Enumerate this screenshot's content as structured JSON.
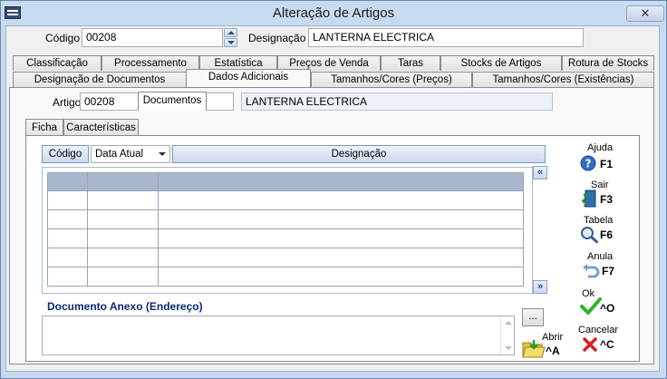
{
  "window": {
    "title": "Alteração de Artigos",
    "close_label": "✕"
  },
  "header": {
    "code_label": "Código",
    "code_value": "00208",
    "designation_label": "Designação",
    "designation_value": "LANTERNA ELECTRICA"
  },
  "tabs_row1": [
    "Classificação",
    "Processamento",
    "Estatística",
    "Preços de Venda",
    "Taras",
    "Stocks de Artigos",
    "Rotura de Stocks"
  ],
  "tabs_row2": [
    "Designação de Documentos",
    "Dados Adicionais",
    "Tamanhos/Cores (Preços)",
    "Tamanhos/Cores (Existências)"
  ],
  "active_tab": "Dados Adicionais",
  "panel": {
    "article_label": "Artigo",
    "article_code": "00208",
    "article_name": "LANTERNA ELECTRICA",
    "inner_tabs": [
      "Ficha",
      "Características",
      "Documentos"
    ],
    "active_inner_tab": "Documentos",
    "grid": {
      "code_button": "Código",
      "date_select": "Data Atual",
      "designation_button": "Designação",
      "scroll_up": "«",
      "scroll_down": "»"
    },
    "attachment_label": "Documento Anexo (Endereço)",
    "browse_label": "...",
    "open_label": "Abrir",
    "open_key": "^A"
  },
  "commands": {
    "help": {
      "label": "Ajuda",
      "key": "F1",
      "icon": "help-icon"
    },
    "exit": {
      "label": "Sair",
      "key": "F3",
      "icon": "exit-door-icon"
    },
    "table": {
      "label": "Tabela",
      "key": "F6",
      "icon": "magnifier-icon"
    },
    "cancel_op": {
      "label": "Anula",
      "key": "F7",
      "icon": "undo-icon"
    },
    "ok": {
      "label": "Ok",
      "key": "^O",
      "icon": "check-icon"
    },
    "cancel": {
      "label": "Cancelar",
      "key": "^C",
      "icon": "x-icon"
    }
  },
  "colors": {
    "frame": "#c7daf0",
    "accent": "#0c2a6e",
    "grid_header": "#a8b7cc"
  }
}
